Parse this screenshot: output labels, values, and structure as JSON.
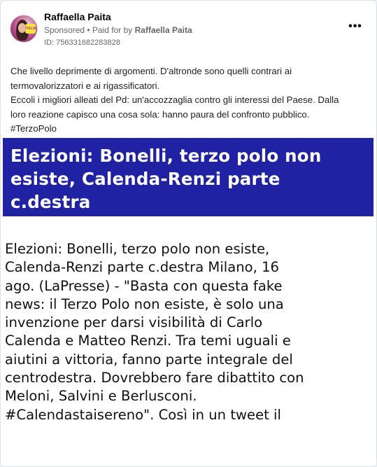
{
  "post": {
    "author": "Raffaella Paita",
    "sponsored_label": "Sponsored",
    "separator": " • ",
    "paid_for_label": "Paid for by ",
    "paid_for_by": "Raffaella Paita",
    "ad_id": "ID: 756331682283828",
    "more_label": "•••",
    "avatar_badge": "ITALIA",
    "text_lines": [
      "Che livello deprimente di argomenti. D'altronde sono quelli contrari ai",
      "termovalorizzatori e ai rigassificatori.",
      "Eccoli i migliori alleati del Pd: un'accozzaglia contro gli interessi del Paese. Dalla",
      "loro reazione capisco una cosa sola: hanno paura del confronto pubblico.",
      "#TerzoPolo"
    ]
  },
  "creative": {
    "banner_lines": [
      "Elezioni: Bonelli, terzo polo non",
      "esiste, Calenda-Renzi parte",
      "c.destra"
    ],
    "article_lines": [
      "Elezioni: Bonelli, terzo polo non esiste,",
      "Calenda-Renzi parte c.destra Milano, 16",
      "ago. (LaPresse) - \"Basta con questa fake",
      "news: il Terzo Polo non esiste, è solo una",
      "invenzione per darsi visibilità di Carlo",
      "Calenda e Matteo Renzi. Tra temi uguali e",
      "aiutini a vittoria, fanno parte integrale del",
      "centrodestra. Dovrebbero fare dibattito con",
      "Meloni, Salvini e Berlusconi.",
      "#Calendastaisereno\". Così in un tweet il"
    ]
  },
  "colors": {
    "banner_background": "#1f22a3",
    "meta_text": "#65676b"
  }
}
